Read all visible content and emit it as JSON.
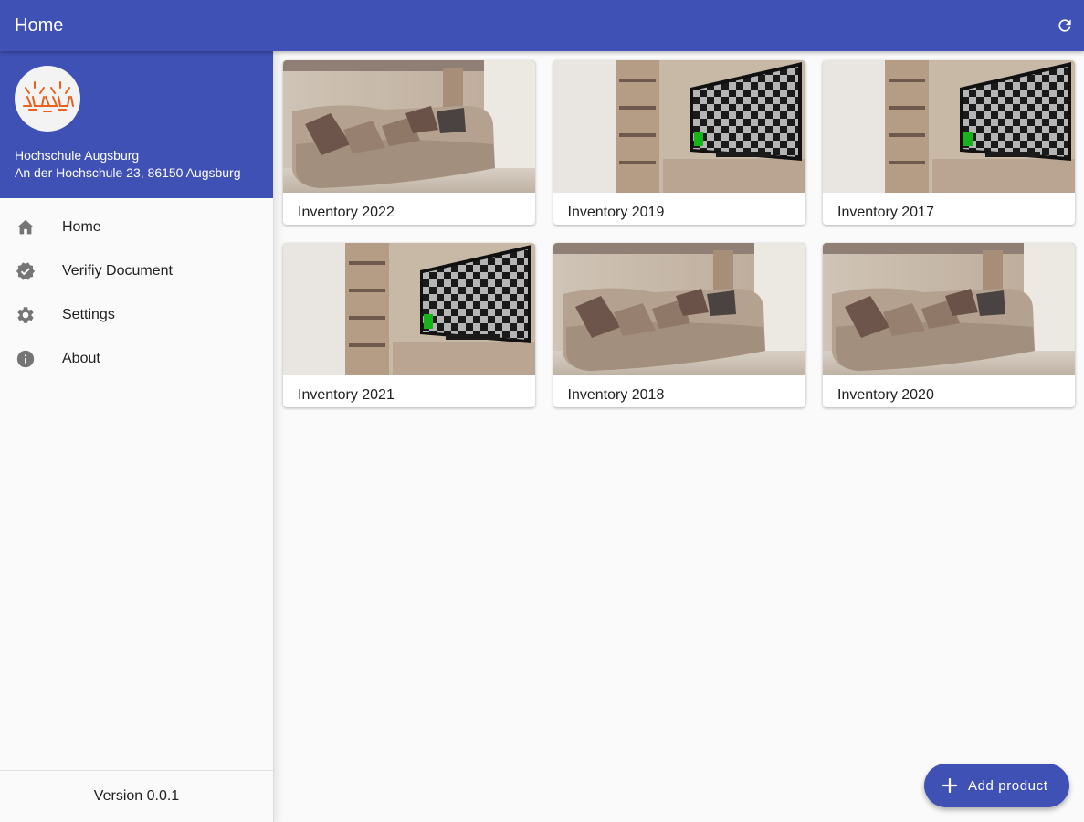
{
  "appbar": {
    "title": "Home",
    "refresh_icon": "refresh-icon"
  },
  "drawer": {
    "account": {
      "name": "Hochschule Augsburg",
      "address": "An der Hochschule 23, 86150 Augsburg",
      "logo": "university-logo"
    },
    "items": [
      {
        "label": "Home",
        "icon": "home-icon"
      },
      {
        "label": "Verifiy Document",
        "icon": "verified-icon"
      },
      {
        "label": "Settings",
        "icon": "gear-icon"
      },
      {
        "label": "About",
        "icon": "info-icon"
      }
    ],
    "version": "Version 0.0.1"
  },
  "products": [
    {
      "title": "Inventory 2022",
      "image": "sofa"
    },
    {
      "title": "Inventory 2019",
      "image": "tv"
    },
    {
      "title": "Inventory 2017",
      "image": "tv"
    },
    {
      "title": "Inventory 2021",
      "image": "tv"
    },
    {
      "title": "Inventory 2018",
      "image": "sofa"
    },
    {
      "title": "Inventory 2020",
      "image": "sofa"
    }
  ],
  "fab": {
    "label": "Add product",
    "icon": "plus-icon"
  },
  "colors": {
    "primary": "#3f51b5",
    "accent_logo": "#e8601c"
  }
}
